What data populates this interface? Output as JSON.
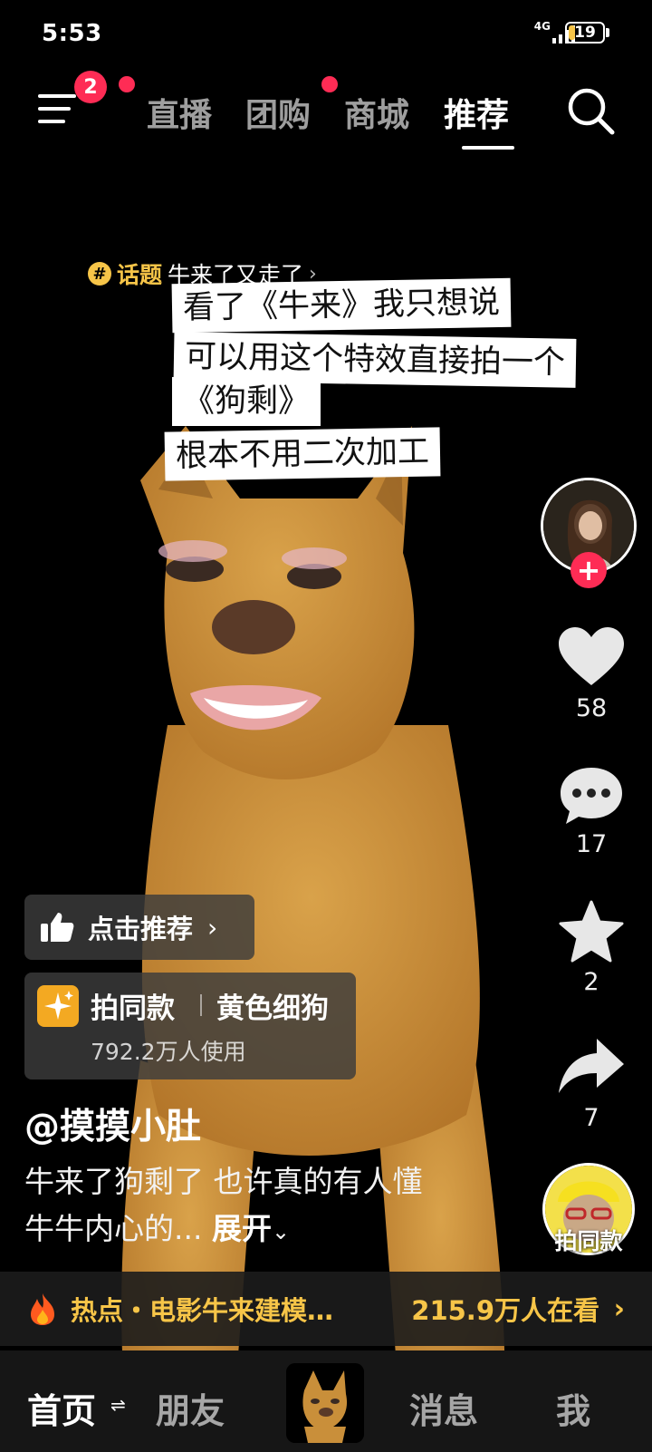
{
  "status_bar": {
    "time": "5:53",
    "network": "4G",
    "battery": "19"
  },
  "top_nav": {
    "menu_badge": "2",
    "tabs": [
      {
        "label": "直播",
        "active": false
      },
      {
        "label": "团购",
        "active": false
      },
      {
        "label": "商城",
        "active": false
      },
      {
        "label": "推荐",
        "active": true
      }
    ],
    "search_icon": "search-icon"
  },
  "topic": {
    "label": "话题",
    "name": "牛来了又走了",
    "chevron": "›"
  },
  "caption_lines": [
    "看了《牛来》我只想说",
    "可以用这个特效直接拍一个",
    "《狗剩》",
    "根本不用二次加工"
  ],
  "actions": {
    "like_count": "58",
    "comment_count": "17",
    "favorite_count": "2",
    "share_count": "7",
    "follow_symbol": "+",
    "shoot_same_label": "拍同款"
  },
  "recommend_button": {
    "label": "点击推荐",
    "chevron": "›"
  },
  "effect_card": {
    "label": "拍同款",
    "name": "黄色细狗",
    "uses": "792.2万人使用"
  },
  "author": "@摸摸小肚",
  "description": {
    "text": "牛来了狗剩了 也许真的有人懂牛牛内心的...",
    "more": "展开"
  },
  "hot_bar": {
    "left": "热点・电影牛来建模…",
    "right": "215.9万人在看",
    "chevron": "›"
  },
  "bottom_nav": {
    "home": "首页",
    "friends": "朋友",
    "messages": "消息",
    "me": "我"
  },
  "colors": {
    "accent": "#fe2c55",
    "gold": "#f7c548",
    "dog": "#c98f3a"
  }
}
